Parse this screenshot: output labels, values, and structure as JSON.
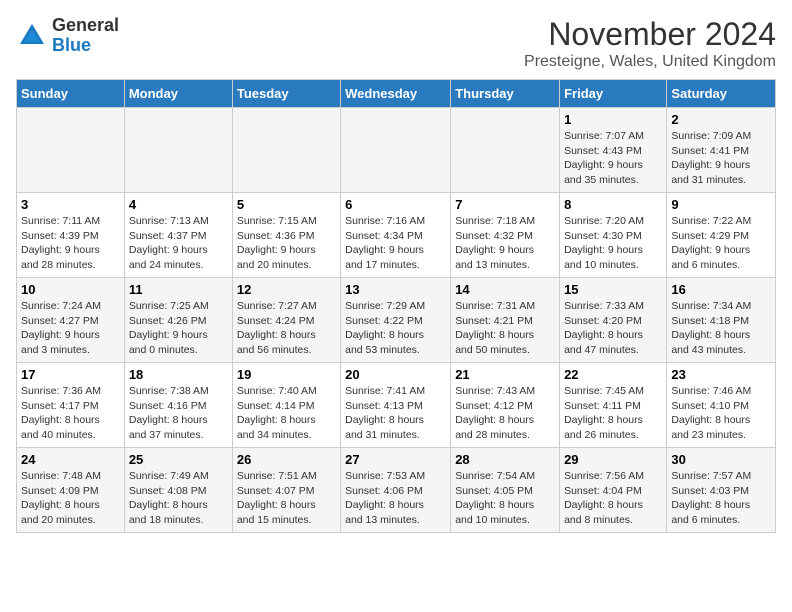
{
  "logo": {
    "general": "General",
    "blue": "Blue"
  },
  "title": {
    "month": "November 2024",
    "location": "Presteigne, Wales, United Kingdom"
  },
  "days_of_week": [
    "Sunday",
    "Monday",
    "Tuesday",
    "Wednesday",
    "Thursday",
    "Friday",
    "Saturday"
  ],
  "weeks": [
    [
      {
        "day": "",
        "info": ""
      },
      {
        "day": "",
        "info": ""
      },
      {
        "day": "",
        "info": ""
      },
      {
        "day": "",
        "info": ""
      },
      {
        "day": "",
        "info": ""
      },
      {
        "day": "1",
        "info": "Sunrise: 7:07 AM\nSunset: 4:43 PM\nDaylight: 9 hours\nand 35 minutes."
      },
      {
        "day": "2",
        "info": "Sunrise: 7:09 AM\nSunset: 4:41 PM\nDaylight: 9 hours\nand 31 minutes."
      }
    ],
    [
      {
        "day": "3",
        "info": "Sunrise: 7:11 AM\nSunset: 4:39 PM\nDaylight: 9 hours\nand 28 minutes."
      },
      {
        "day": "4",
        "info": "Sunrise: 7:13 AM\nSunset: 4:37 PM\nDaylight: 9 hours\nand 24 minutes."
      },
      {
        "day": "5",
        "info": "Sunrise: 7:15 AM\nSunset: 4:36 PM\nDaylight: 9 hours\nand 20 minutes."
      },
      {
        "day": "6",
        "info": "Sunrise: 7:16 AM\nSunset: 4:34 PM\nDaylight: 9 hours\nand 17 minutes."
      },
      {
        "day": "7",
        "info": "Sunrise: 7:18 AM\nSunset: 4:32 PM\nDaylight: 9 hours\nand 13 minutes."
      },
      {
        "day": "8",
        "info": "Sunrise: 7:20 AM\nSunset: 4:30 PM\nDaylight: 9 hours\nand 10 minutes."
      },
      {
        "day": "9",
        "info": "Sunrise: 7:22 AM\nSunset: 4:29 PM\nDaylight: 9 hours\nand 6 minutes."
      }
    ],
    [
      {
        "day": "10",
        "info": "Sunrise: 7:24 AM\nSunset: 4:27 PM\nDaylight: 9 hours\nand 3 minutes."
      },
      {
        "day": "11",
        "info": "Sunrise: 7:25 AM\nSunset: 4:26 PM\nDaylight: 9 hours\nand 0 minutes."
      },
      {
        "day": "12",
        "info": "Sunrise: 7:27 AM\nSunset: 4:24 PM\nDaylight: 8 hours\nand 56 minutes."
      },
      {
        "day": "13",
        "info": "Sunrise: 7:29 AM\nSunset: 4:22 PM\nDaylight: 8 hours\nand 53 minutes."
      },
      {
        "day": "14",
        "info": "Sunrise: 7:31 AM\nSunset: 4:21 PM\nDaylight: 8 hours\nand 50 minutes."
      },
      {
        "day": "15",
        "info": "Sunrise: 7:33 AM\nSunset: 4:20 PM\nDaylight: 8 hours\nand 47 minutes."
      },
      {
        "day": "16",
        "info": "Sunrise: 7:34 AM\nSunset: 4:18 PM\nDaylight: 8 hours\nand 43 minutes."
      }
    ],
    [
      {
        "day": "17",
        "info": "Sunrise: 7:36 AM\nSunset: 4:17 PM\nDaylight: 8 hours\nand 40 minutes."
      },
      {
        "day": "18",
        "info": "Sunrise: 7:38 AM\nSunset: 4:16 PM\nDaylight: 8 hours\nand 37 minutes."
      },
      {
        "day": "19",
        "info": "Sunrise: 7:40 AM\nSunset: 4:14 PM\nDaylight: 8 hours\nand 34 minutes."
      },
      {
        "day": "20",
        "info": "Sunrise: 7:41 AM\nSunset: 4:13 PM\nDaylight: 8 hours\nand 31 minutes."
      },
      {
        "day": "21",
        "info": "Sunrise: 7:43 AM\nSunset: 4:12 PM\nDaylight: 8 hours\nand 28 minutes."
      },
      {
        "day": "22",
        "info": "Sunrise: 7:45 AM\nSunset: 4:11 PM\nDaylight: 8 hours\nand 26 minutes."
      },
      {
        "day": "23",
        "info": "Sunrise: 7:46 AM\nSunset: 4:10 PM\nDaylight: 8 hours\nand 23 minutes."
      }
    ],
    [
      {
        "day": "24",
        "info": "Sunrise: 7:48 AM\nSunset: 4:09 PM\nDaylight: 8 hours\nand 20 minutes."
      },
      {
        "day": "25",
        "info": "Sunrise: 7:49 AM\nSunset: 4:08 PM\nDaylight: 8 hours\nand 18 minutes."
      },
      {
        "day": "26",
        "info": "Sunrise: 7:51 AM\nSunset: 4:07 PM\nDaylight: 8 hours\nand 15 minutes."
      },
      {
        "day": "27",
        "info": "Sunrise: 7:53 AM\nSunset: 4:06 PM\nDaylight: 8 hours\nand 13 minutes."
      },
      {
        "day": "28",
        "info": "Sunrise: 7:54 AM\nSunset: 4:05 PM\nDaylight: 8 hours\nand 10 minutes."
      },
      {
        "day": "29",
        "info": "Sunrise: 7:56 AM\nSunset: 4:04 PM\nDaylight: 8 hours\nand 8 minutes."
      },
      {
        "day": "30",
        "info": "Sunrise: 7:57 AM\nSunset: 4:03 PM\nDaylight: 8 hours\nand 6 minutes."
      }
    ]
  ]
}
